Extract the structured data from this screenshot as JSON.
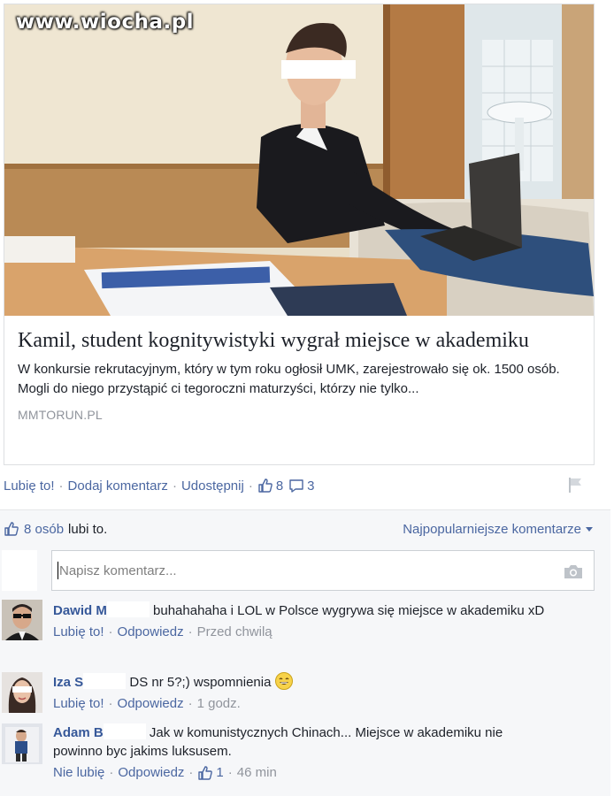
{
  "watermark": "www.wiocha.pl",
  "post": {
    "title": "Kamil, student kognitywistyki wygrał miejsce w akademiku",
    "description": "W konkursie rekrutacyjnym, który w tym roku ogłosił UMK, zarejestrowało się ok. 1500 osób. Mogli do niego przystąpić ci tegoroczni maturzyści, którzy nie tylko...",
    "domain": "MMTORUN.PL"
  },
  "actions": {
    "like": "Lubię to!",
    "comment": "Dodaj komentarz",
    "share": "Udostępnij",
    "like_count": "8",
    "comment_count": "3",
    "sep": "·"
  },
  "likes_bar": {
    "people_link": "8 osób",
    "suffix": "lubi to.",
    "sort": "Najpopularniejsze komentarze"
  },
  "comment_input": {
    "placeholder": "Napisz komentarz..."
  },
  "comments": [
    {
      "name": "Dawid M",
      "text": "buhahahaha i LOL w Polsce wygrywa się miejsce w akademiku xD",
      "like": "Lubię to!",
      "reply": "Odpowiedz",
      "time": "Przed chwilą"
    },
    {
      "name": "Iza S",
      "text": "DS nr 5?;) wspomnienia",
      "like": "Lubię to!",
      "reply": "Odpowiedz",
      "time": "1 godz."
    },
    {
      "name": "Adam B",
      "text": "Jak w komunistycznych Chinach... Miejsce w akademiku nie powinno byc jakims luksusem.",
      "like": "Nie lubię",
      "reply": "Odpowiedz",
      "like_count": "1",
      "time": "46 min"
    }
  ]
}
